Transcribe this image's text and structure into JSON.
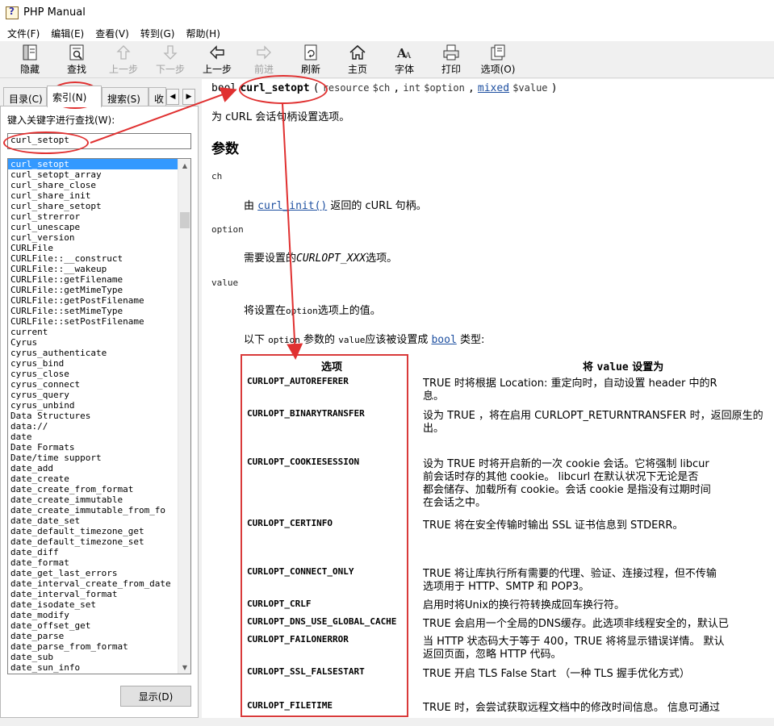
{
  "window": {
    "title": "PHP Manual"
  },
  "menu": [
    "文件(F)",
    "编辑(E)",
    "查看(V)",
    "转到(G)",
    "帮助(H)"
  ],
  "toolbar": [
    {
      "label": "隐藏",
      "icon": "hide-icon",
      "enabled": true
    },
    {
      "label": "查找",
      "icon": "find-icon",
      "enabled": true
    },
    {
      "label": "上一步",
      "icon": "up-arrow-icon",
      "enabled": false
    },
    {
      "label": "下一步",
      "icon": "down-arrow-icon",
      "enabled": false
    },
    {
      "label": "上一步",
      "icon": "back-icon",
      "enabled": true
    },
    {
      "label": "前进",
      "icon": "forward-icon",
      "enabled": false
    },
    {
      "label": "刷新",
      "icon": "refresh-icon",
      "enabled": true
    },
    {
      "label": "主页",
      "icon": "home-icon",
      "enabled": true
    },
    {
      "label": "字体",
      "icon": "font-icon",
      "enabled": true
    },
    {
      "label": "打印",
      "icon": "print-icon",
      "enabled": true
    },
    {
      "label": "选项(O)",
      "icon": "options-icon",
      "enabled": true
    }
  ],
  "left": {
    "tabs": [
      "目录(C)",
      "索引(N)",
      "搜索(S)",
      "收"
    ],
    "active_tab": "索引(N)",
    "keyword_label": "键入关键字进行查找(W):",
    "keyword_value": "curl_setopt",
    "display_button": "显示(D)",
    "list": [
      "curl_setopt",
      "curl_setopt_array",
      "curl_share_close",
      "curl_share_init",
      "curl_share_setopt",
      "curl_strerror",
      "curl_unescape",
      "curl_version",
      "CURLFile",
      "CURLFile::__construct",
      "CURLFile::__wakeup",
      "CURLFile::getFilename",
      "CURLFile::getMimeType",
      "CURLFile::getPostFilename",
      "CURLFile::setMimeType",
      "CURLFile::setPostFilename",
      "current",
      "Cyrus",
      "cyrus_authenticate",
      "cyrus_bind",
      "cyrus_close",
      "cyrus_connect",
      "cyrus_query",
      "cyrus_unbind",
      "Data Structures",
      "data://",
      "date",
      "Date Formats",
      "Date/time support",
      "date_add",
      "date_create",
      "date_create_from_format",
      "date_create_immutable",
      "date_create_immutable_from_fo",
      "date_date_set",
      "date_default_timezone_get",
      "date_default_timezone_set",
      "date_diff",
      "date_format",
      "date_get_last_errors",
      "date_interval_create_from_date",
      "date_interval_format",
      "date_isodate_set",
      "date_modify",
      "date_offset_get",
      "date_parse",
      "date_parse_from_format",
      "date_sub",
      "date_sun_info"
    ],
    "selected_index": 0
  },
  "content": {
    "sig_return": "bool",
    "sig_func": "curl_setopt",
    "sig_open": "(",
    "sig_t1": "resource",
    "sig_p1": "$ch",
    "sig_comma1": ",",
    "sig_t2": "int",
    "sig_p2": "$option",
    "sig_comma2": ",",
    "sig_t3": "mixed",
    "sig_p3": "$value",
    "sig_close": ")",
    "description": "为 cURL 会话句柄设置选项。",
    "params_heading": "参数",
    "param_ch": "ch",
    "param_ch_pre": "由",
    "param_ch_link": "curl_init()",
    "param_ch_post": "返回的 cURL 句柄。",
    "param_option": "option",
    "param_option_pre": "需要设置的",
    "param_option_code": "CURLOPT_XXX",
    "param_option_post": "选项。",
    "param_value": "value",
    "param_value_pre": "将设置在",
    "param_value_code": "option",
    "param_value_post": "选项上的值。",
    "bool_pre": "以下",
    "bool_code1": "option",
    "bool_mid": "参数的",
    "bool_code2": "value",
    "bool_mid2": "应该被设置成",
    "bool_link": "bool",
    "bool_post": "类型:",
    "table": {
      "col1": "选项",
      "col2_pre": "将",
      "col2_code": "value",
      "col2_post": "设置为",
      "rows": [
        {
          "name": "CURLOPT_AUTOREFERER",
          "desc": "TRUE 时将根据 Location: 重定向时，自动设置 header 中的R\n息。"
        },
        {
          "name": "CURLOPT_BINARYTRANSFER",
          "desc": "设为 TRUE ，将在启用 CURLOPT_RETURNTRANSFER 时，返回原生的\n出。"
        },
        {
          "name": "CURLOPT_COOKIESESSION",
          "desc": "设为 TRUE 时将开启新的一次 cookie 会话。它将强制 libcur\n前会话时存的其他 cookie。 libcurl 在默认状况下无论是否\n都会储存、加载所有 cookie。会话 cookie 是指没有过期时间\n在会话之中。"
        },
        {
          "name": "CURLOPT_CERTINFO",
          "desc": "TRUE 将在安全传输时输出 SSL 证书信息到 STDERR。"
        },
        {
          "name": "CURLOPT_CONNECT_ONLY",
          "desc": "TRUE 将让库执行所有需要的代理、验证、连接过程，但不传输\n选项用于 HTTP、SMTP 和 POP3。"
        },
        {
          "name": "CURLOPT_CRLF",
          "desc": "启用时将Unix的换行符转换成回车换行符。"
        },
        {
          "name": "CURLOPT_DNS_USE_GLOBAL_CACHE",
          "desc": "TRUE 会启用一个全局的DNS缓存。此选项非线程安全的，默认已"
        },
        {
          "name": "CURLOPT_FAILONERROR",
          "desc": "当 HTTP 状态码大于等于 400，TRUE 将将显示错误详情。 默认\n返回页面，忽略 HTTP 代码。"
        },
        {
          "name": "CURLOPT_SSL_FALSESTART",
          "desc": "TRUE 开启 TLS False Start （一种 TLS 握手优化方式）"
        },
        {
          "name": "CURLOPT_FILETIME",
          "desc": "TRUE 时，会尝试获取远程文档中的修改时间信息。 信息可通过"
        }
      ]
    }
  }
}
